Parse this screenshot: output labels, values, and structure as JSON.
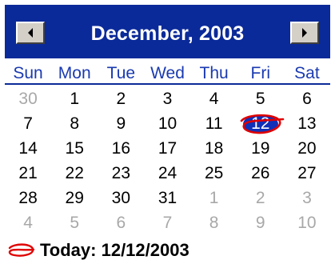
{
  "calendar": {
    "month_title": "December, 2003",
    "prev_button_icon": "left-arrow-icon",
    "next_button_icon": "right-arrow-icon",
    "weekdays": [
      "Sun",
      "Mon",
      "Tue",
      "Wed",
      "Thu",
      "Fri",
      "Sat"
    ],
    "weeks": [
      [
        {
          "d": "30",
          "other": true
        },
        {
          "d": "1"
        },
        {
          "d": "2"
        },
        {
          "d": "3"
        },
        {
          "d": "4"
        },
        {
          "d": "5"
        },
        {
          "d": "6"
        }
      ],
      [
        {
          "d": "7"
        },
        {
          "d": "8"
        },
        {
          "d": "9"
        },
        {
          "d": "10"
        },
        {
          "d": "11"
        },
        {
          "d": "12",
          "today": true
        },
        {
          "d": "13"
        }
      ],
      [
        {
          "d": "14"
        },
        {
          "d": "15"
        },
        {
          "d": "16"
        },
        {
          "d": "17"
        },
        {
          "d": "18"
        },
        {
          "d": "19"
        },
        {
          "d": "20"
        }
      ],
      [
        {
          "d": "21"
        },
        {
          "d": "22"
        },
        {
          "d": "23"
        },
        {
          "d": "24"
        },
        {
          "d": "25"
        },
        {
          "d": "26"
        },
        {
          "d": "27"
        }
      ],
      [
        {
          "d": "28"
        },
        {
          "d": "29"
        },
        {
          "d": "30"
        },
        {
          "d": "31"
        },
        {
          "d": "1",
          "other": true
        },
        {
          "d": "2",
          "other": true
        },
        {
          "d": "3",
          "other": true
        }
      ],
      [
        {
          "d": "4",
          "other": true
        },
        {
          "d": "5",
          "other": true
        },
        {
          "d": "6",
          "other": true
        },
        {
          "d": "7",
          "other": true
        },
        {
          "d": "8",
          "other": true
        },
        {
          "d": "9",
          "other": true
        },
        {
          "d": "10",
          "other": true
        }
      ]
    ],
    "today_label": "Today: 12/12/2003"
  },
  "colors": {
    "title_bg": "#0b2a99",
    "weekday_text": "#1a3ab0",
    "other_month_text": "#a8a8a8",
    "selection_fill": "#1030b8",
    "today_ring": "#e00000"
  }
}
